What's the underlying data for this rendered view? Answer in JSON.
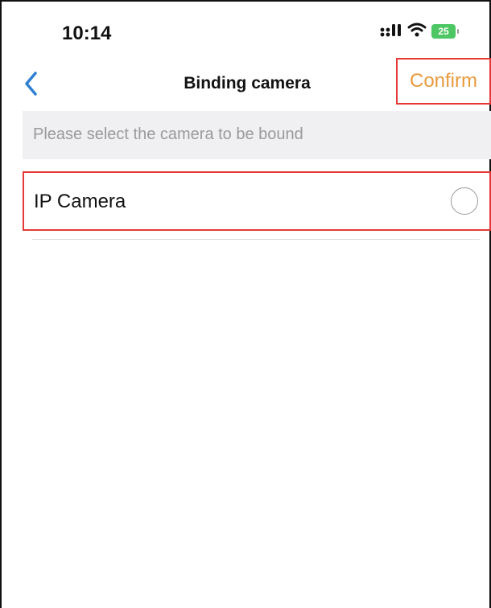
{
  "status_bar": {
    "time": "10:14",
    "battery": "25",
    "icons": [
      "signal-icon",
      "wifi-icon",
      "battery-icon"
    ]
  },
  "nav": {
    "back_icon": "chevron-left-icon",
    "title": "Binding camera",
    "confirm_label": "Confirm"
  },
  "hint": {
    "text": "Please select the camera to be bound"
  },
  "cameras": [
    {
      "label": "IP Camera",
      "selected": false
    }
  ],
  "colors": {
    "accent_orange": "#e89a3c",
    "back_blue": "#2f80d1",
    "highlight_red": "#e53935",
    "battery_green": "#4cc764",
    "hint_background": "#f0f0f2",
    "hint_text": "#9a9a9a"
  }
}
